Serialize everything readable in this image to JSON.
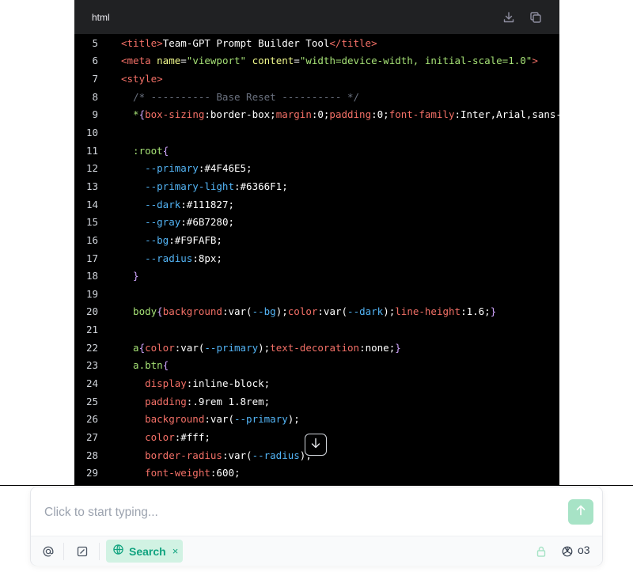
{
  "code_block": {
    "language": "html",
    "lines": [
      {
        "n": "5",
        "parts": [
          [
            "tk-tag",
            "<title>"
          ],
          [
            "tk-punc",
            "Team-GPT Prompt Builder Tool"
          ],
          [
            "tk-tag",
            "</title>"
          ]
        ]
      },
      {
        "n": "6",
        "parts": [
          [
            "tk-tag",
            "<meta "
          ],
          [
            "tk-attr",
            "name"
          ],
          [
            "tk-punc",
            "="
          ],
          [
            "tk-str",
            "\"viewport\""
          ],
          [
            "tk-punc",
            " "
          ],
          [
            "tk-attr",
            "content"
          ],
          [
            "tk-punc",
            "="
          ],
          [
            "tk-str",
            "\"width=device-width, initial-scale=1.0\""
          ],
          [
            "tk-tag",
            ">"
          ]
        ]
      },
      {
        "n": "7",
        "parts": [
          [
            "tk-tag",
            "<style>"
          ]
        ]
      },
      {
        "n": "8",
        "parts": [
          [
            "tk-cmt",
            "  /* ---------- Base Reset ---------- */"
          ]
        ]
      },
      {
        "n": "9",
        "parts": [
          [
            "tk-sel",
            "  *"
          ],
          [
            "tk-brace",
            "{"
          ],
          [
            "tk-prop",
            "box-sizing"
          ],
          [
            "tk-punc",
            ":border-box;"
          ],
          [
            "tk-prop",
            "margin"
          ],
          [
            "tk-punc",
            ":0;"
          ],
          [
            "tk-prop",
            "padding"
          ],
          [
            "tk-punc",
            ":0;"
          ],
          [
            "tk-prop",
            "font-family"
          ],
          [
            "tk-punc",
            ":Inter,Arial,sans-serif;"
          ]
        ]
      },
      {
        "n": "10",
        "parts": [
          [
            "tk-punc",
            ""
          ]
        ]
      },
      {
        "n": "11",
        "parts": [
          [
            "tk-sel",
            "  :root"
          ],
          [
            "tk-brace",
            "{"
          ]
        ]
      },
      {
        "n": "12",
        "parts": [
          [
            "tk-var",
            "    --primary"
          ],
          [
            "tk-punc",
            ":#4F46E5;"
          ]
        ]
      },
      {
        "n": "13",
        "parts": [
          [
            "tk-var",
            "    --primary-light"
          ],
          [
            "tk-punc",
            ":#6366F1;"
          ]
        ]
      },
      {
        "n": "14",
        "parts": [
          [
            "tk-var",
            "    --dark"
          ],
          [
            "tk-punc",
            ":#111827;"
          ]
        ]
      },
      {
        "n": "15",
        "parts": [
          [
            "tk-var",
            "    --gray"
          ],
          [
            "tk-punc",
            ":#6B7280;"
          ]
        ]
      },
      {
        "n": "16",
        "parts": [
          [
            "tk-var",
            "    --bg"
          ],
          [
            "tk-punc",
            ":#F9FAFB;"
          ]
        ]
      },
      {
        "n": "17",
        "parts": [
          [
            "tk-var",
            "    --radius"
          ],
          [
            "tk-punc",
            ":8px;"
          ]
        ]
      },
      {
        "n": "18",
        "parts": [
          [
            "tk-brace",
            "  }"
          ]
        ]
      },
      {
        "n": "19",
        "parts": [
          [
            "tk-punc",
            ""
          ]
        ]
      },
      {
        "n": "20",
        "parts": [
          [
            "tk-sel",
            "  body"
          ],
          [
            "tk-brace",
            "{"
          ],
          [
            "tk-prop",
            "background"
          ],
          [
            "tk-punc",
            ":var("
          ],
          [
            "tk-var",
            "--bg"
          ],
          [
            "tk-punc",
            ");"
          ],
          [
            "tk-prop",
            "color"
          ],
          [
            "tk-punc",
            ":var("
          ],
          [
            "tk-var",
            "--dark"
          ],
          [
            "tk-punc",
            ");"
          ],
          [
            "tk-prop",
            "line-height"
          ],
          [
            "tk-punc",
            ":1.6;"
          ],
          [
            "tk-brace",
            "}"
          ]
        ]
      },
      {
        "n": "21",
        "parts": [
          [
            "tk-punc",
            ""
          ]
        ]
      },
      {
        "n": "22",
        "parts": [
          [
            "tk-sel",
            "  a"
          ],
          [
            "tk-brace",
            "{"
          ],
          [
            "tk-prop",
            "color"
          ],
          [
            "tk-punc",
            ":var("
          ],
          [
            "tk-var",
            "--primary"
          ],
          [
            "tk-punc",
            ");"
          ],
          [
            "tk-prop",
            "text-decoration"
          ],
          [
            "tk-punc",
            ":none;"
          ],
          [
            "tk-brace",
            "}"
          ]
        ]
      },
      {
        "n": "23",
        "parts": [
          [
            "tk-sel",
            "  a.btn"
          ],
          [
            "tk-brace",
            "{"
          ]
        ]
      },
      {
        "n": "24",
        "parts": [
          [
            "tk-prop",
            "    display"
          ],
          [
            "tk-punc",
            ":inline-block;"
          ]
        ]
      },
      {
        "n": "25",
        "parts": [
          [
            "tk-prop",
            "    padding"
          ],
          [
            "tk-punc",
            ":.9rem 1.8rem;"
          ]
        ]
      },
      {
        "n": "26",
        "parts": [
          [
            "tk-prop",
            "    background"
          ],
          [
            "tk-punc",
            ":var("
          ],
          [
            "tk-var",
            "--primary"
          ],
          [
            "tk-punc",
            ");"
          ]
        ]
      },
      {
        "n": "27",
        "parts": [
          [
            "tk-prop",
            "    color"
          ],
          [
            "tk-punc",
            ":#fff;"
          ]
        ]
      },
      {
        "n": "28",
        "parts": [
          [
            "tk-prop",
            "    border-radius"
          ],
          [
            "tk-punc",
            ":var("
          ],
          [
            "tk-var",
            "--radius"
          ],
          [
            "tk-punc",
            ");"
          ]
        ]
      },
      {
        "n": "29",
        "parts": [
          [
            "tk-prop",
            "    font-weight"
          ],
          [
            "tk-punc",
            ":600;"
          ]
        ]
      }
    ]
  },
  "icons": {
    "download": "download-icon",
    "copy": "copy-icon",
    "scroll_down": "arrow-down-icon",
    "send": "arrow-up-icon",
    "mention": "at-sign-icon",
    "edit": "edit-square-icon",
    "globe": "globe-icon",
    "close": "x-icon",
    "lock": "lock-icon",
    "model": "openai-icon"
  },
  "composer": {
    "placeholder": "Click to start typing...",
    "search_chip_label": "Search",
    "chip_close": "×",
    "model_label": "o3"
  },
  "colors": {
    "accent": "#10a37f",
    "send_button": "#a7e3c6",
    "chip_background": "#d1f2e3"
  }
}
